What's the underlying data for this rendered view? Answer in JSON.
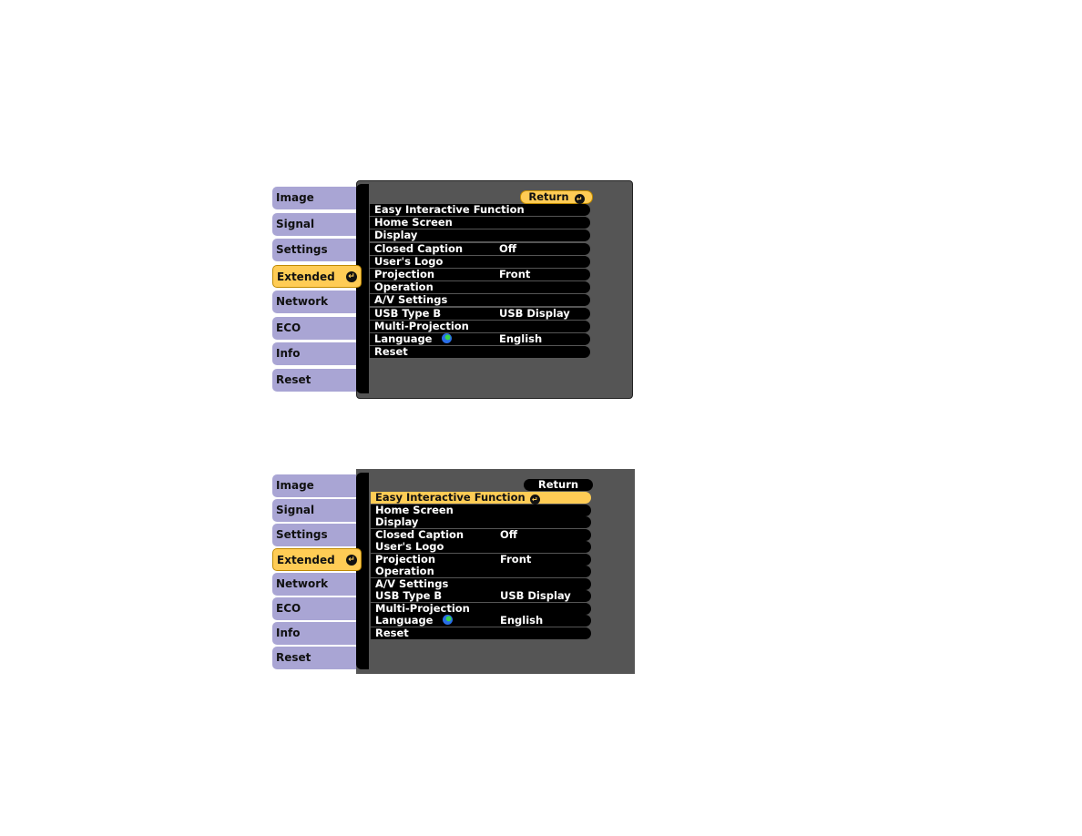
{
  "menus": [
    {
      "tabs": [
        "Image",
        "Signal",
        "Settings",
        "Extended",
        "Network",
        "ECO",
        "Info",
        "Reset"
      ],
      "active_tab": "Extended",
      "return_label": "Return",
      "selected_item": "Return",
      "items": [
        {
          "label": "Easy Interactive Function",
          "value": ""
        },
        {
          "label": "Home Screen",
          "value": ""
        },
        {
          "label": "Display",
          "value": ""
        },
        {
          "label": "Closed Caption",
          "value": "Off"
        },
        {
          "label": "User's Logo",
          "value": ""
        },
        {
          "label": "Projection",
          "value": "Front"
        },
        {
          "label": "Operation",
          "value": ""
        },
        {
          "label": "A/V Settings",
          "value": ""
        },
        {
          "label": "USB Type B",
          "value": "USB Display"
        },
        {
          "label": "Multi-Projection",
          "value": ""
        },
        {
          "label": "Language",
          "value": "English",
          "icon": "globe-icon"
        },
        {
          "label": "Reset",
          "value": ""
        }
      ]
    },
    {
      "tabs": [
        "Image",
        "Signal",
        "Settings",
        "Extended",
        "Network",
        "ECO",
        "Info",
        "Reset"
      ],
      "active_tab": "Extended",
      "return_label": "Return",
      "selected_item": "Easy Interactive Function",
      "items": [
        {
          "label": "Easy Interactive Function",
          "value": ""
        },
        {
          "label": "Home Screen",
          "value": ""
        },
        {
          "label": "Display",
          "value": ""
        },
        {
          "label": "Closed Caption",
          "value": "Off"
        },
        {
          "label": "User's Logo",
          "value": ""
        },
        {
          "label": "Projection",
          "value": "Front"
        },
        {
          "label": "Operation",
          "value": ""
        },
        {
          "label": "A/V Settings",
          "value": ""
        },
        {
          "label": "USB Type B",
          "value": "USB Display"
        },
        {
          "label": "Multi-Projection",
          "value": ""
        },
        {
          "label": "Language",
          "value": "English",
          "icon": "globe-icon"
        },
        {
          "label": "Reset",
          "value": ""
        }
      ]
    }
  ],
  "colors": {
    "tab": "#a9a5d4",
    "highlight": "#ffcc55",
    "panel": "#555555",
    "row": "#000000"
  }
}
